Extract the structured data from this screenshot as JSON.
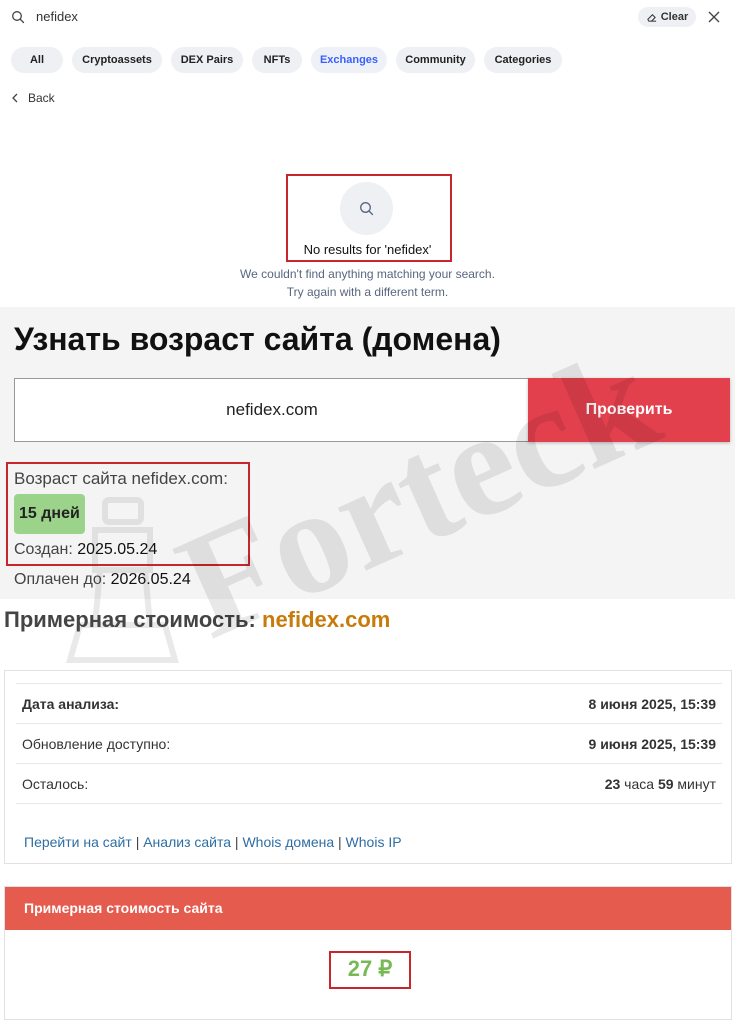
{
  "search": {
    "query": "nefidex",
    "clear_label": "Clear",
    "filters": [
      "All",
      "Cryptoassets",
      "DEX Pairs",
      "NFTs",
      "Exchanges",
      "Community",
      "Categories"
    ],
    "active_filter": "Exchanges",
    "back_label": "Back",
    "no_results_title": "No results for 'nefidex'",
    "no_results_line1": "We couldn't find anything matching your search.",
    "no_results_line2": "Try again with a different term."
  },
  "domain_age": {
    "title": "Узнать возраст сайта (домена)",
    "input_value": "nefidex.com",
    "check_button": "Проверить",
    "age_label": "Возраст сайта nefidex.com:",
    "age_value": "15 дней",
    "created_label": "Создан:",
    "created_value": "2025.05.24",
    "paid_label": "Оплачен до:",
    "paid_value": "2026.05.24"
  },
  "estimate": {
    "heading": "Примерная стоимость:",
    "domain": "nefidex.com",
    "rows": [
      {
        "key": "Дата анализа:",
        "value": "8 июня 2025, 15:39"
      },
      {
        "key": "Обновление доступно:",
        "value": "9 июня 2025, 15:39"
      },
      {
        "key": "Осталось:",
        "hours": "23",
        "hours_unit": "часа",
        "minutes": "59",
        "minutes_unit": "минут"
      }
    ],
    "links": [
      "Перейти на сайт",
      "Анализ сайта",
      "Whois домена",
      "Whois IP"
    ],
    "link_separator": "|",
    "price_header": "Примерная стоимость сайта",
    "price_value": "27 ₽"
  },
  "watermark": "Forteck",
  "colors": {
    "active_filter": "#3861fb",
    "highlight_border": "#c8262d",
    "check_button": "#e2404d",
    "age_badge": "#9cd38b",
    "domain_accent": "#c87b0b",
    "price_header": "#e55c4f",
    "price_value": "#78b956",
    "link": "#2f6ea4"
  }
}
